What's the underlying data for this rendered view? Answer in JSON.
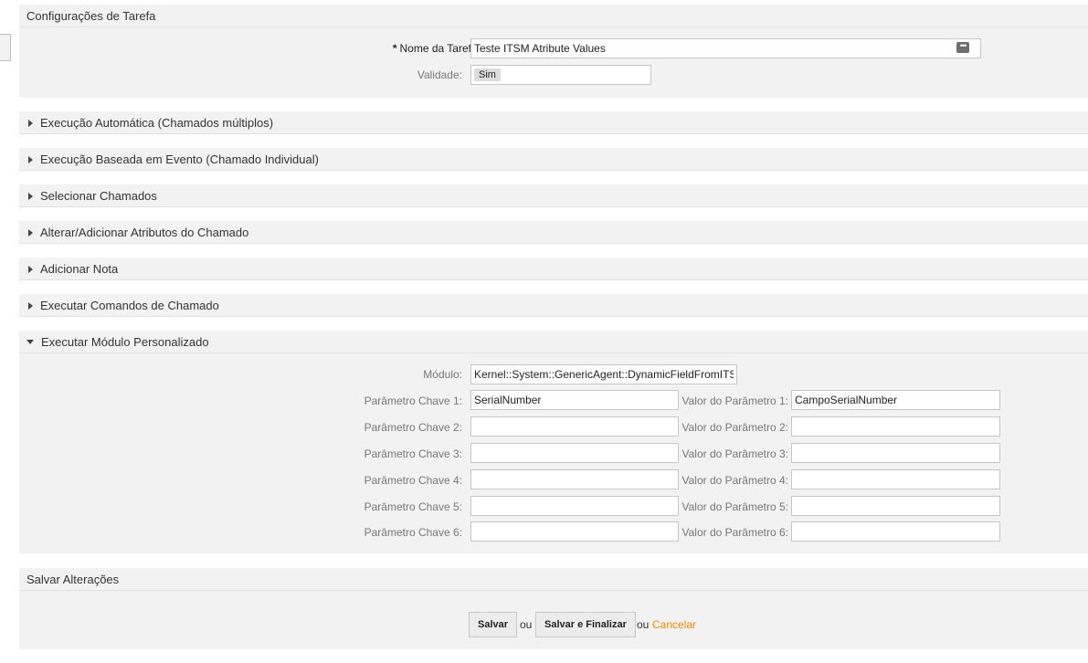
{
  "task_settings": {
    "header": "Configurações de Tarefa",
    "required_mark": "*",
    "name_label": "Nome da Tarefa:",
    "name_value": "Teste ITSM Atribute Values",
    "validity_label": "Validade:",
    "validity_value": "Sim"
  },
  "sections": [
    {
      "label": "Execução Automática (Chamados múltiplos)",
      "expanded": false
    },
    {
      "label": "Execução Baseada em Evento (Chamado Individual)",
      "expanded": false
    },
    {
      "label": "Selecionar Chamados",
      "expanded": false
    },
    {
      "label": "Alterar/Adicionar Atributos do Chamado",
      "expanded": false
    },
    {
      "label": "Adicionar Nota",
      "expanded": false
    },
    {
      "label": "Executar Comandos de Chamado",
      "expanded": false
    }
  ],
  "custom_module": {
    "header": "Executar Módulo Personalizado",
    "module_label": "Módulo:",
    "module_value": "Kernel::System::GenericAgent::DynamicFieldFromITS",
    "params": [
      {
        "key_label": "Parâmetro Chave 1:",
        "key_value": "SerialNumber",
        "val_label": "Valor do Parâmetro 1:",
        "val_value": "CampoSerialNumber"
      },
      {
        "key_label": "Parâmetro Chave 2:",
        "key_value": "",
        "val_label": "Valor do Parâmetro 2:",
        "val_value": ""
      },
      {
        "key_label": "Parâmetro Chave 3:",
        "key_value": "",
        "val_label": "Valor do Parâmetro 3:",
        "val_value": ""
      },
      {
        "key_label": "Parâmetro Chave 4:",
        "key_value": "",
        "val_label": "Valor do Parâmetro 4:",
        "val_value": ""
      },
      {
        "key_label": "Parâmetro Chave 5:",
        "key_value": "",
        "val_label": "Valor do Parâmetro 5:",
        "val_value": ""
      },
      {
        "key_label": "Parâmetro Chave 6:",
        "key_value": "",
        "val_label": "Valor do Parâmetro 6:",
        "val_value": ""
      }
    ]
  },
  "save_section": {
    "header": "Salvar Alterações",
    "save_label": "Salvar",
    "or_1": "ou",
    "save_finish_label": "Salvar e Finalizar",
    "or_2": "ou",
    "cancel_label": "Cancelar"
  },
  "colors": {
    "panel_bg": "#f2f2f2",
    "cancel_link": "#f28b00"
  },
  "icons": {
    "collapsed": "triangle-right-icon",
    "expanded": "triangle-down-icon",
    "field_menu": "more-dots-icon"
  }
}
